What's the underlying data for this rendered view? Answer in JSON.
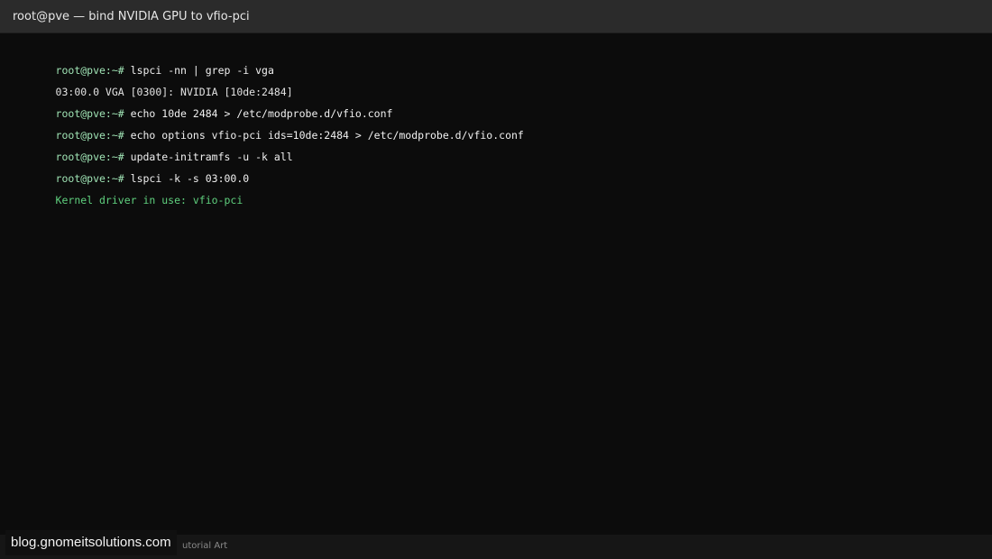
{
  "window": {
    "title": "root@pve — bind NVIDIA GPU to vfio-pci"
  },
  "terminal": {
    "lines": [
      {
        "type": "command",
        "prompt": "root@pve:~#",
        "text": "lspci -nn | grep -i vga"
      },
      {
        "type": "output",
        "text": "03:00.0 VGA [0300]: NVIDIA [10de:2484]"
      },
      {
        "type": "command",
        "prompt": "root@pve:~#",
        "text": "echo 10de 2484 > /etc/modprobe.d/vfio.conf"
      },
      {
        "type": "command",
        "prompt": "root@pve:~#",
        "text": "echo options vfio-pci ids=10de:2484 > /etc/modprobe.d/vfio.conf"
      },
      {
        "type": "command",
        "prompt": "root@pve:~#",
        "text": "update-initramfs -u -k all"
      },
      {
        "type": "command",
        "prompt": "root@pve:~#",
        "text": "lspci -k -s 03:00.0"
      },
      {
        "type": "success",
        "text": "Kernel driver in use: vfio-pci"
      }
    ]
  },
  "footer": {
    "caption_visible_part": "utorial Art",
    "watermark": "blog.gnomeitsolutions.com"
  },
  "colors": {
    "background": "#0c0c0c",
    "titlebar": "#2b2b2b",
    "prompt": "#9fe3b4",
    "command": "#f0f0f0",
    "output": "#e2e2e2",
    "success": "#5fd07e"
  }
}
